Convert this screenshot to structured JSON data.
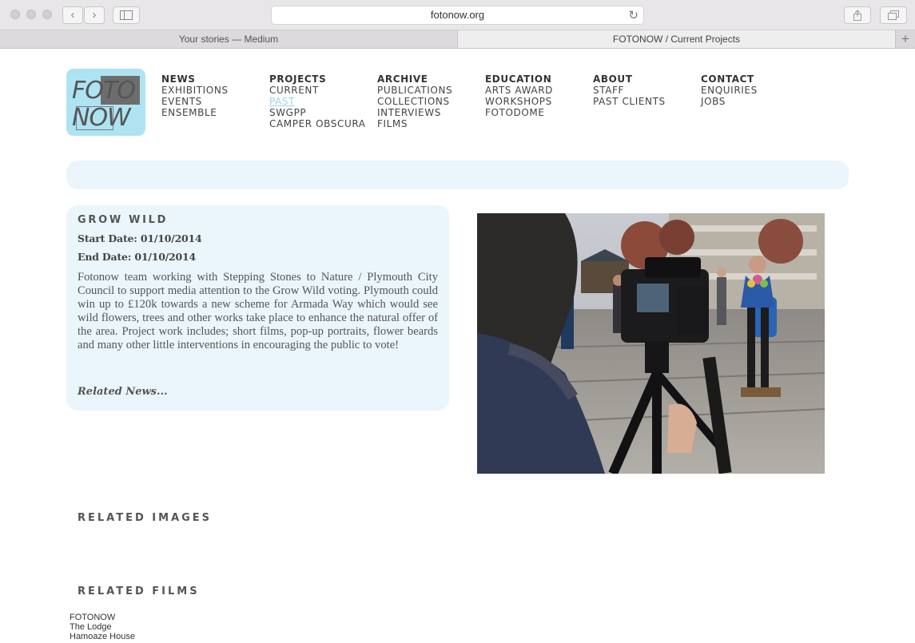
{
  "browser": {
    "address": "fotonow.org",
    "back_glyph": "‹",
    "forward_glyph": "›",
    "reload_glyph": "↻",
    "new_tab_glyph": "+",
    "tabs": [
      {
        "label": "Your stories — Medium"
      },
      {
        "label": "FOTONOW / Current Projects"
      }
    ]
  },
  "logo": {
    "line1": "FOTO",
    "line2": "NOW",
    "color": "#aee3f2"
  },
  "nav": [
    {
      "heading": "NEWS",
      "items": [
        "EXHIBITIONS",
        "EVENTS",
        "ENSEMBLE"
      ]
    },
    {
      "heading": "PROJECTS",
      "items": [
        "CURRENT",
        "PAST",
        "SWGPP",
        "CAMPER OBSCURA"
      ]
    },
    {
      "heading": "ARCHIVE",
      "items": [
        "PUBLICATIONS",
        "COLLECTIONS",
        "INTERVIEWS",
        "FILMS"
      ]
    },
    {
      "heading": "EDUCATION",
      "items": [
        "ARTS AWARD",
        "WORKSHOPS",
        "FOTODOME"
      ]
    },
    {
      "heading": "ABOUT",
      "items": [
        "STAFF",
        "PAST CLIENTS"
      ]
    },
    {
      "heading": "CONTACT",
      "items": [
        "ENQUIRIES",
        "JOBS"
      ]
    }
  ],
  "project": {
    "title": "GROW WILD",
    "start": "Start Date: 01/10/2014",
    "end": "End Date: 01/10/2014",
    "description": "Fotonow team working with Stepping Stones to Nature / Plymouth City Council to support media attention to the Grow Wild voting. Plymouth could win up to £120k towards a new scheme for Armada Way which would see wild flowers, trees and other works take place to enhance the natural offer of the area. Project work includes; short films, pop-up portraits, flower beards and many other little interventions in encouraging the public to vote!",
    "related_news": "Related News..."
  },
  "sections": {
    "related_images": "RELATED IMAGES",
    "related_films": "RELATED FILMS"
  },
  "films": [
    "FOTONOW",
    "The Lodge",
    "Hamoaze House"
  ],
  "colors": {
    "accent_light": "#eaf6fc",
    "link_selected": "#9ed3e6"
  }
}
